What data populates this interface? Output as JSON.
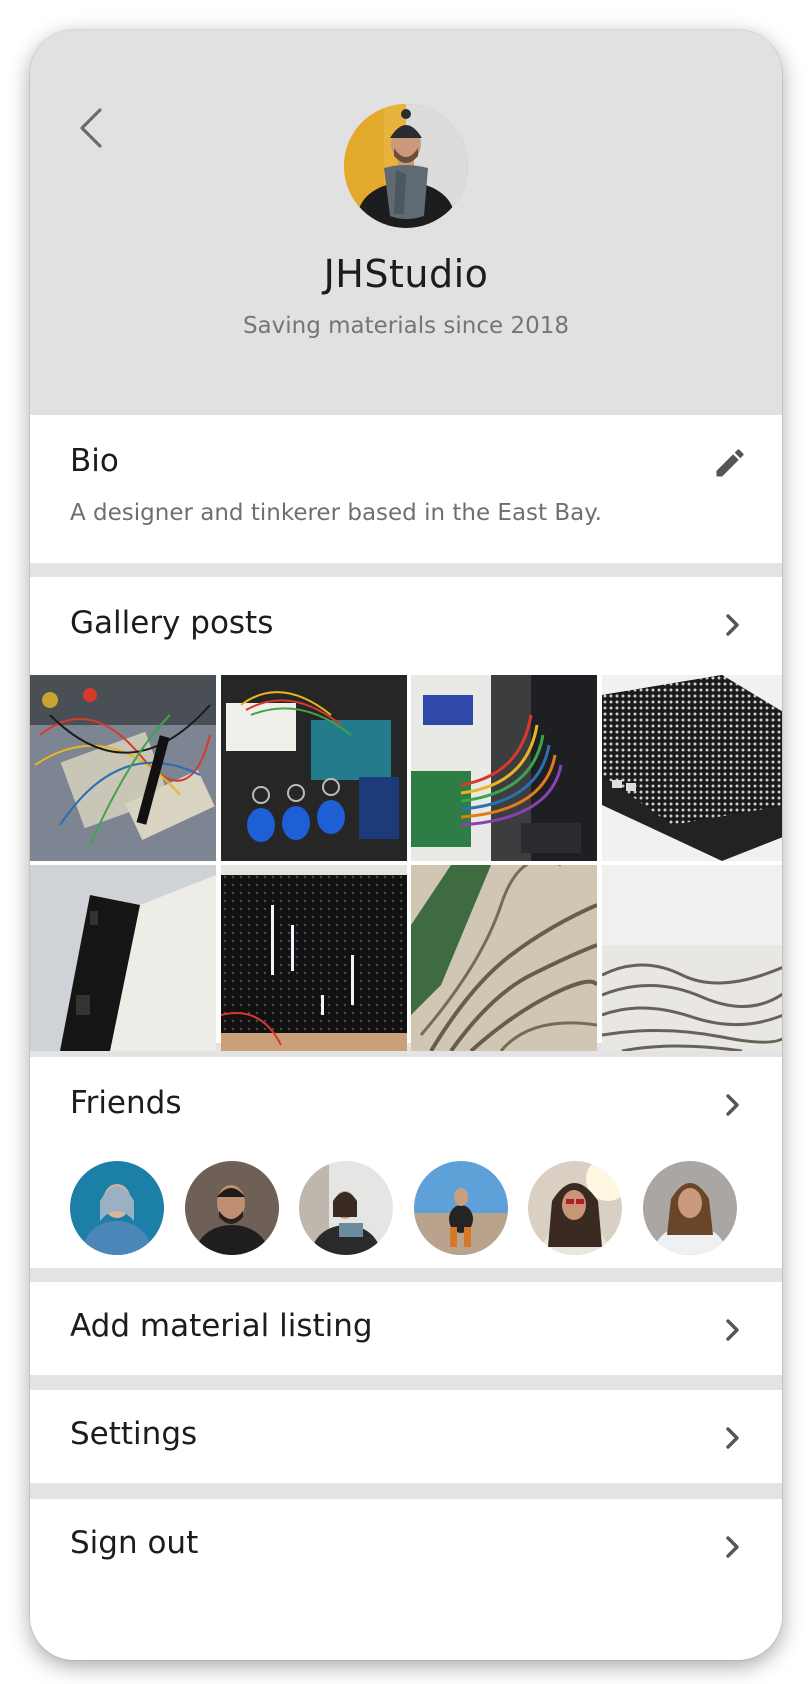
{
  "profile": {
    "name": "JHStudio",
    "tagline": "Saving materials since 2018"
  },
  "bio": {
    "title": "Bio",
    "text": "A designer and tinkerer based in the East Bay."
  },
  "gallery": {
    "title": "Gallery posts"
  },
  "friends": {
    "title": "Friends"
  },
  "menu": {
    "add_listing": "Add material listing",
    "settings": "Settings",
    "sign_out": "Sign out"
  },
  "icons": {
    "back": "chevron-left-icon",
    "edit": "pencil-icon",
    "forward": "chevron-right-icon"
  },
  "colors": {
    "header_bg": "#e1e1e1",
    "separator": "#e3e3e3",
    "icon": "#555555",
    "muted_text": "#757575"
  }
}
